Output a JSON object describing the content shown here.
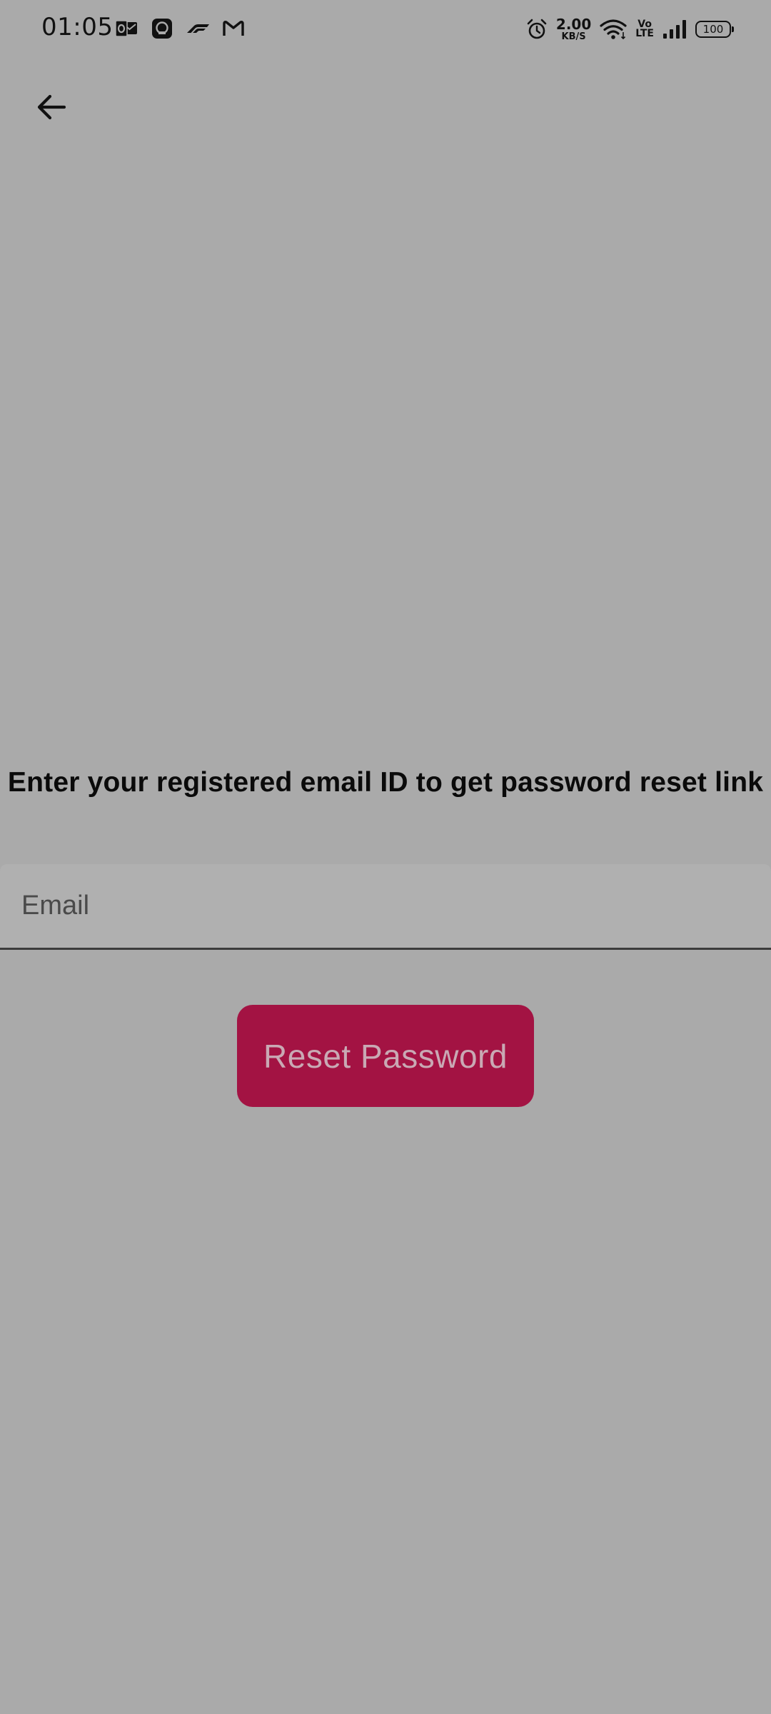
{
  "status_bar": {
    "time": "01:05",
    "notification_icons": [
      "outlook-icon",
      "signal-app-icon",
      "f1-icon",
      "gmail-icon"
    ],
    "system_icons": [
      "alarm-icon",
      "wifi-icon",
      "signal-strength-icon",
      "battery-icon"
    ],
    "network_speed_value": "2.00",
    "network_speed_unit": "KB/S",
    "volte_top": "Vo",
    "volte_bottom": "LTE",
    "battery_level": "100"
  },
  "header": {
    "back_icon": "arrow-left-icon"
  },
  "main": {
    "instruction": "Enter your registered email ID to get password reset link",
    "email_placeholder": "Email",
    "email_value": "",
    "reset_button_label": "Reset Password"
  },
  "colors": {
    "background": "#aaaaaa",
    "field_background": "#b0b0b0",
    "button_background": "#a31343",
    "button_text": "#c9a9b4"
  }
}
